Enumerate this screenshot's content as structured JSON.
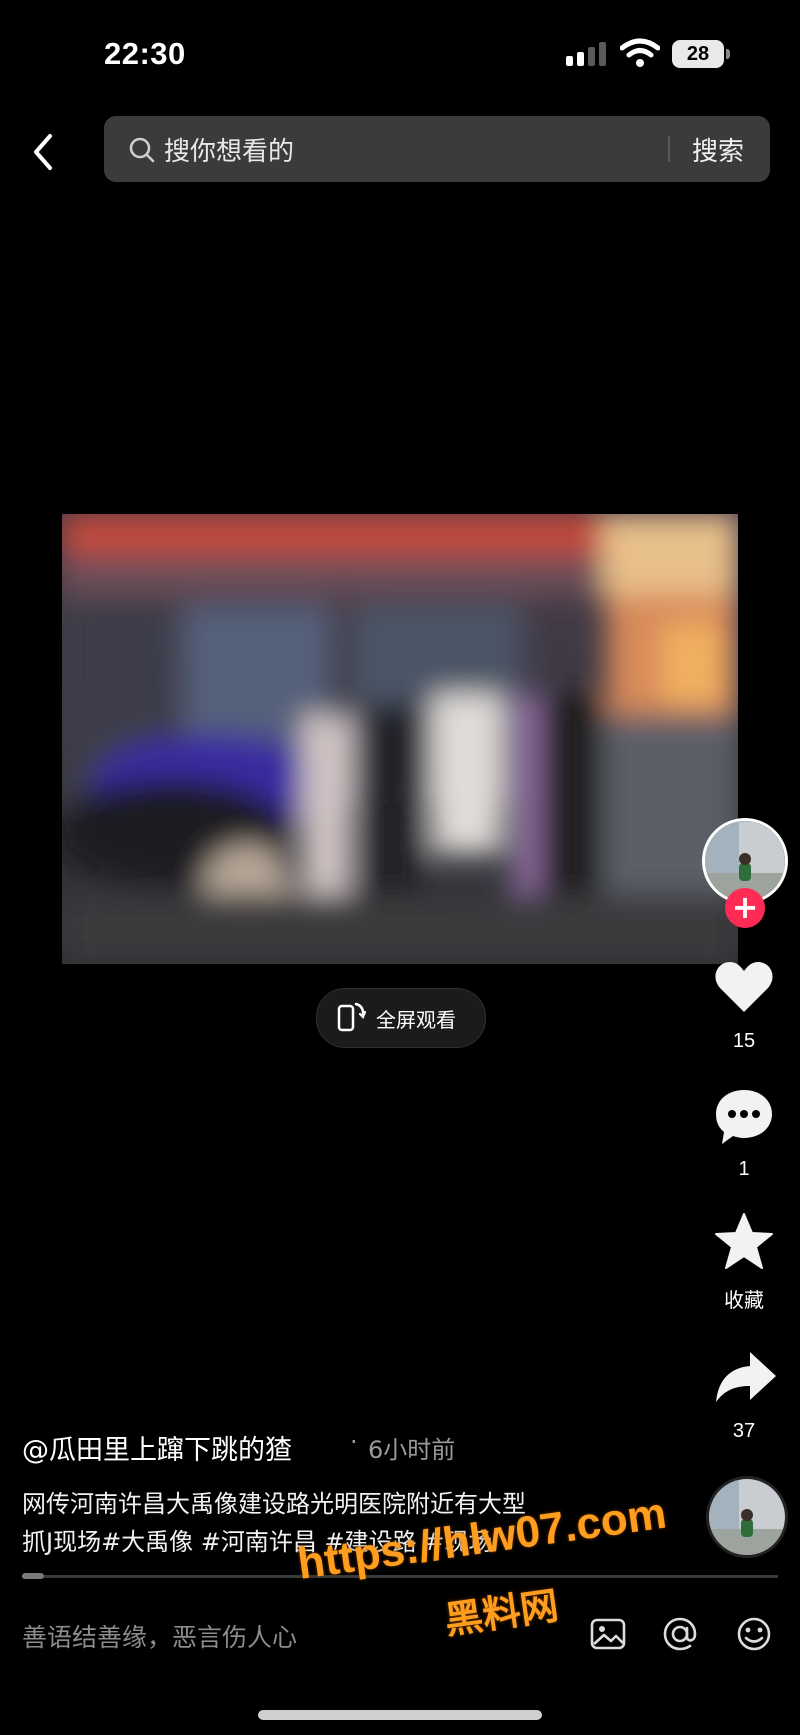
{
  "status_bar": {
    "time": "22:30",
    "battery": "28"
  },
  "header": {
    "search_placeholder": "搜你想看的",
    "search_button": "搜索"
  },
  "video": {
    "fullscreen_label": "全屏观看"
  },
  "actions": {
    "likes": "15",
    "comments": "1",
    "favorite_label": "收藏",
    "shares": "37"
  },
  "post": {
    "author": "@瓜田里上蹿下跳的猹",
    "separator": "·",
    "time": "6小时前",
    "description_line1": "网传河南许昌大禹像建设路光明医院附近有大型",
    "description_line2": "抓J现场#大禹像 #河南许昌 #建设路 #现场"
  },
  "watermark": {
    "url": "https://hlw07.com",
    "name": "黑料网"
  },
  "comment_bar": {
    "placeholder": "善语结善缘，恶言伤人心"
  },
  "colors": {
    "accent": "#fe2c55",
    "watermark": "#ff9d1e",
    "background": "#000000"
  },
  "icons": {
    "back": "chevron-left-icon",
    "search": "search-icon",
    "like": "heart-icon",
    "comment": "comment-bubble-icon",
    "favorite": "star-icon",
    "share": "share-arrow-icon",
    "image": "image-icon",
    "mention": "at-icon",
    "emoji": "emoji-icon"
  }
}
